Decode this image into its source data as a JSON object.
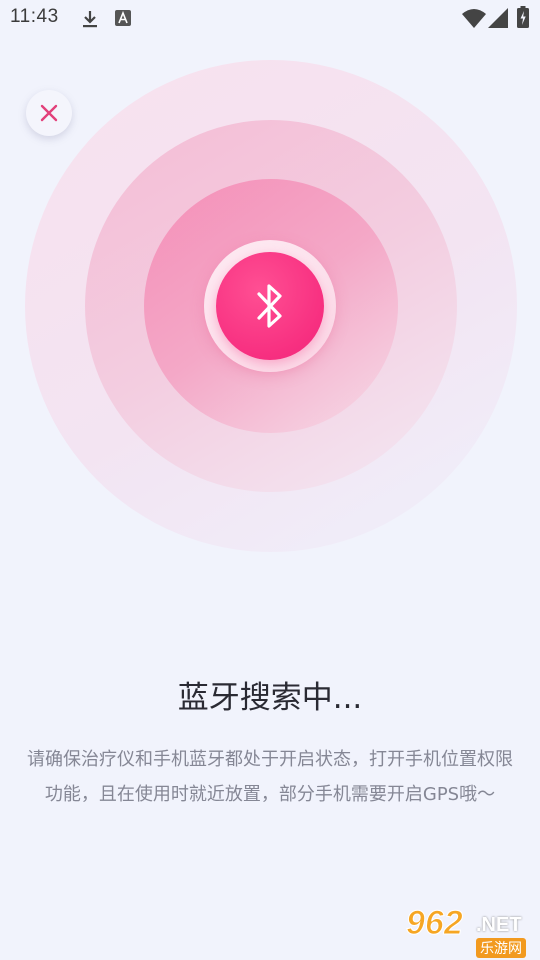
{
  "status_bar": {
    "time": "11:43",
    "icons": [
      "download-icon",
      "font-icon",
      "wifi-icon",
      "signal-icon",
      "battery-charging-icon"
    ]
  },
  "radar": {
    "center_icon": "bluetooth-icon",
    "colors": {
      "accent": "#f72f80",
      "ring_outer": "#f3e4f2",
      "ring_middle": "#f3c3da",
      "ring_inner": "#f59dc0"
    }
  },
  "close": {
    "icon": "close-icon",
    "color": "#e2407a"
  },
  "content": {
    "title": "蓝牙搜索中...",
    "description": "请确保治疗仪和手机蓝牙都处于开启状态，打开手机位置权限功能，且在使用时就近放置，部分手机需要开启GPS哦～"
  },
  "watermark": {
    "number": "962",
    "suffix": ".NET",
    "site": "乐游网"
  }
}
